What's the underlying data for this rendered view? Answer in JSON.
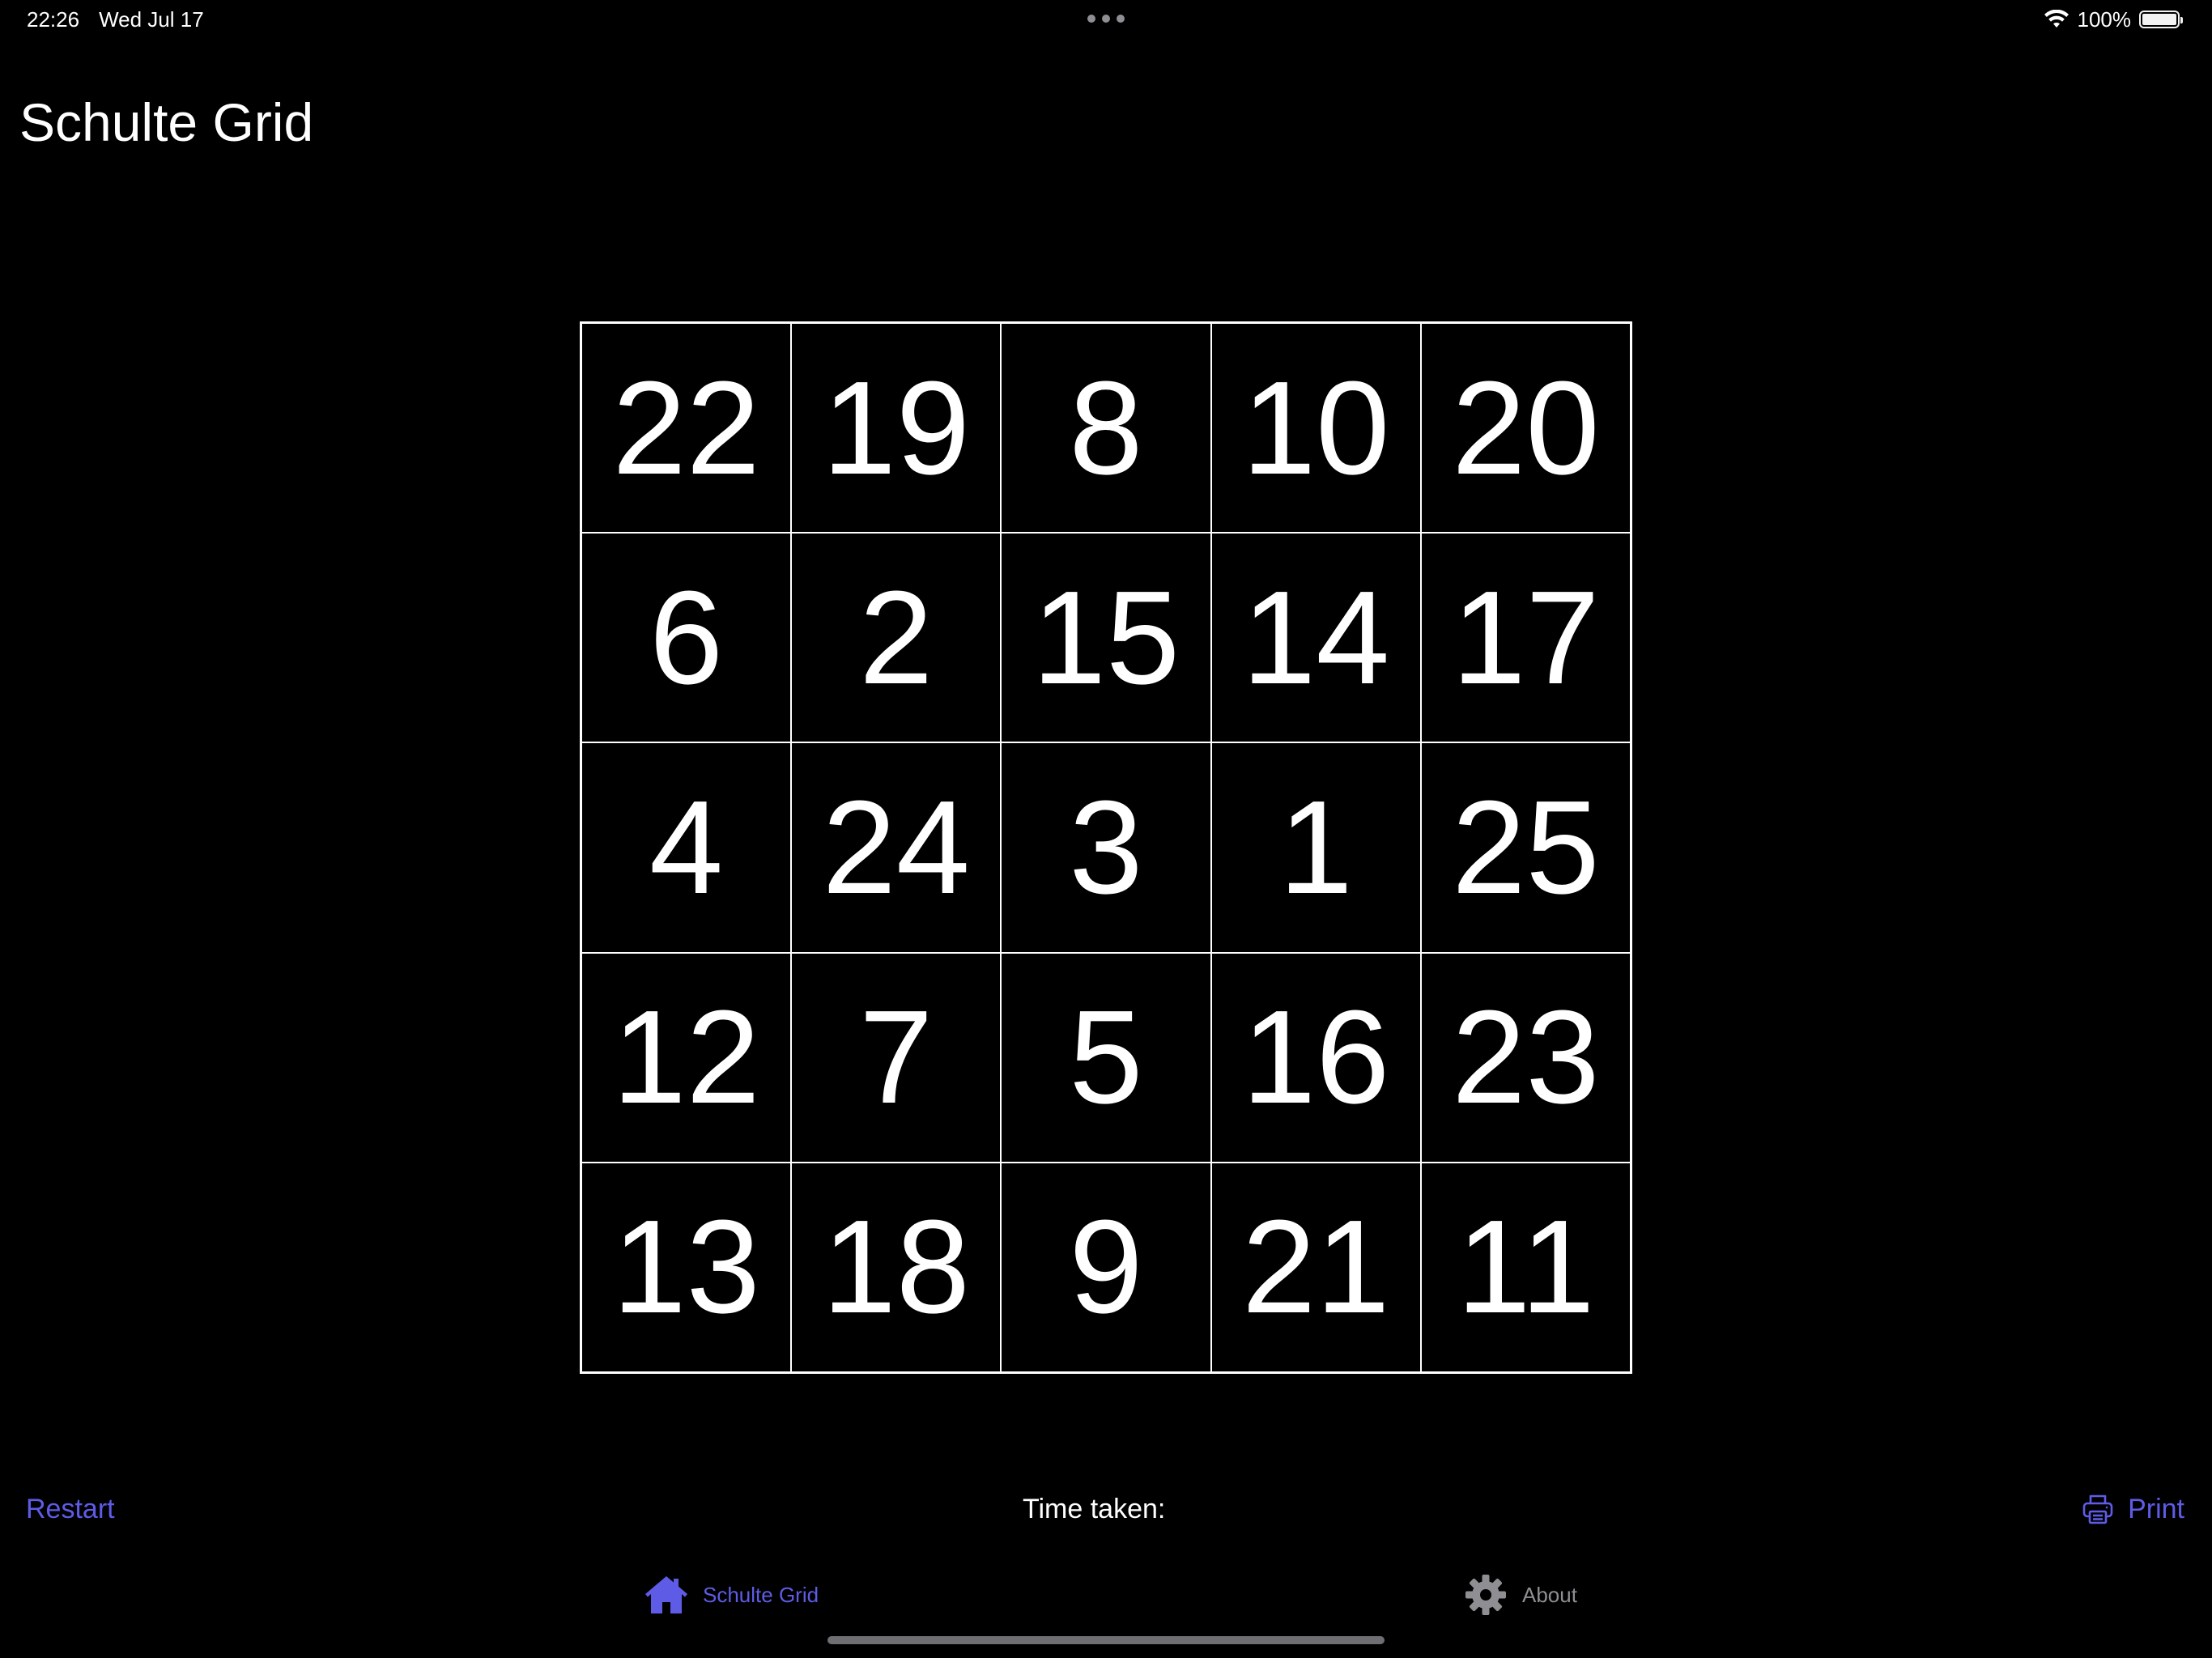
{
  "status_bar": {
    "time": "22:26",
    "date": "Wed Jul 17",
    "battery": "100%",
    "battery_level": 1.0
  },
  "header": {
    "title": "Schulte Grid"
  },
  "grid": {
    "cells": [
      "22",
      "19",
      "8",
      "10",
      "20",
      "6",
      "2",
      "15",
      "14",
      "17",
      "4",
      "24",
      "3",
      "1",
      "25",
      "12",
      "7",
      "5",
      "16",
      "23",
      "13",
      "18",
      "9",
      "21",
      "11"
    ]
  },
  "controls": {
    "restart_label": "Restart",
    "time_label": "Time taken:",
    "print_label": "Print"
  },
  "tabs": [
    {
      "label": "Schulte Grid",
      "icon": "house-icon",
      "active": true
    },
    {
      "label": "About",
      "icon": "gear-icon",
      "active": false
    }
  ],
  "colors": {
    "accent": "#5e5ce6",
    "inactive": "#8e8e93",
    "background": "#000000",
    "text": "#ffffff"
  }
}
